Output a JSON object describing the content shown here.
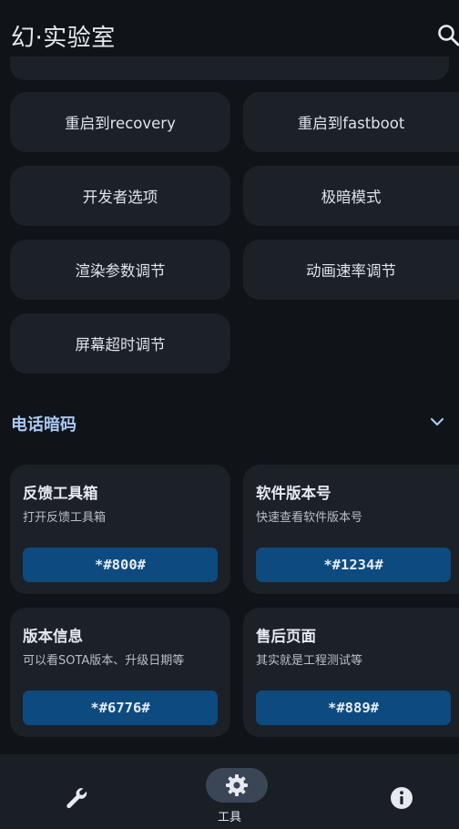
{
  "app": {
    "title": "幻·实验室"
  },
  "actions": [
    {
      "label": "重启到recovery"
    },
    {
      "label": "重启到fastboot"
    },
    {
      "label": "开发者选项"
    },
    {
      "label": "极暗模式"
    },
    {
      "label": "渲染参数调节"
    },
    {
      "label": "动画速率调节"
    },
    {
      "label": "屏幕超时调节"
    }
  ],
  "section": {
    "title": "电话暗码"
  },
  "codes": [
    {
      "title": "反馈工具箱",
      "desc": "打开反馈工具箱",
      "code": "*#800#"
    },
    {
      "title": "软件版本号",
      "desc": "快速查看软件版本号",
      "code": "*#1234#"
    },
    {
      "title": "版本信息",
      "desc": "可以看SOTA版本、升级日期等",
      "code": "*#6776#"
    },
    {
      "title": "售后页面",
      "desc": "其实就是工程测试等",
      "code": "*#889#"
    }
  ],
  "bottom_nav": {
    "items": [
      {
        "icon": "wrench-icon",
        "label": ""
      },
      {
        "icon": "gear-icon",
        "label": "工具",
        "selected": true
      },
      {
        "icon": "info-icon",
        "label": ""
      }
    ]
  },
  "colors": {
    "background": "#101419",
    "card": "#1c2027",
    "accent_text": "#a9c8f2",
    "code_button": "#0d4a80",
    "nav_bar": "#1a1e25",
    "nav_pill": "#3a4656"
  }
}
